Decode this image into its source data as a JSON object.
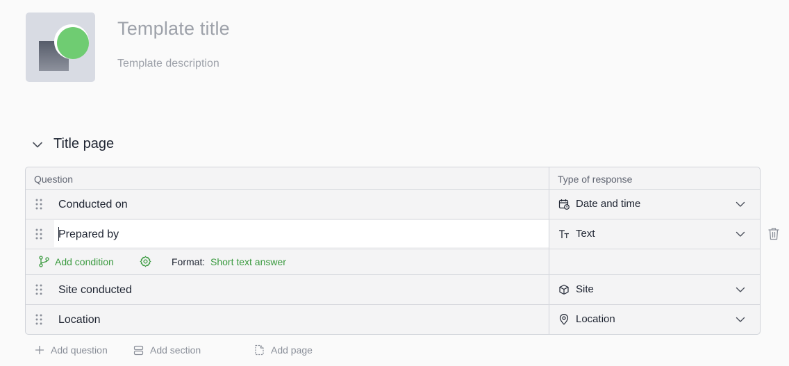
{
  "header": {
    "title_placeholder": "Template title",
    "description_placeholder": "Template description"
  },
  "section": {
    "title": "Title page"
  },
  "table": {
    "columns": [
      "Question",
      "Type of response"
    ],
    "rows": [
      {
        "question": "Conducted on",
        "response": "Date and time",
        "icon": "calendar-clock-icon"
      },
      {
        "question": "Prepared by",
        "response": "Text",
        "icon": "text-type-icon",
        "editing": true
      },
      {
        "question": "Site conducted",
        "response": "Site",
        "icon": "cube-icon"
      },
      {
        "question": "Location",
        "response": "Location",
        "icon": "map-pin-icon"
      }
    ],
    "options": {
      "add_condition": "Add condition",
      "format_label": "Format:",
      "format_value": "Short text answer"
    }
  },
  "actions": {
    "add_question": "Add question",
    "add_section": "Add section",
    "add_page": "Add page"
  },
  "colors": {
    "accent_green": "#3a9a3f",
    "thumb_circle": "#6fcc72"
  }
}
